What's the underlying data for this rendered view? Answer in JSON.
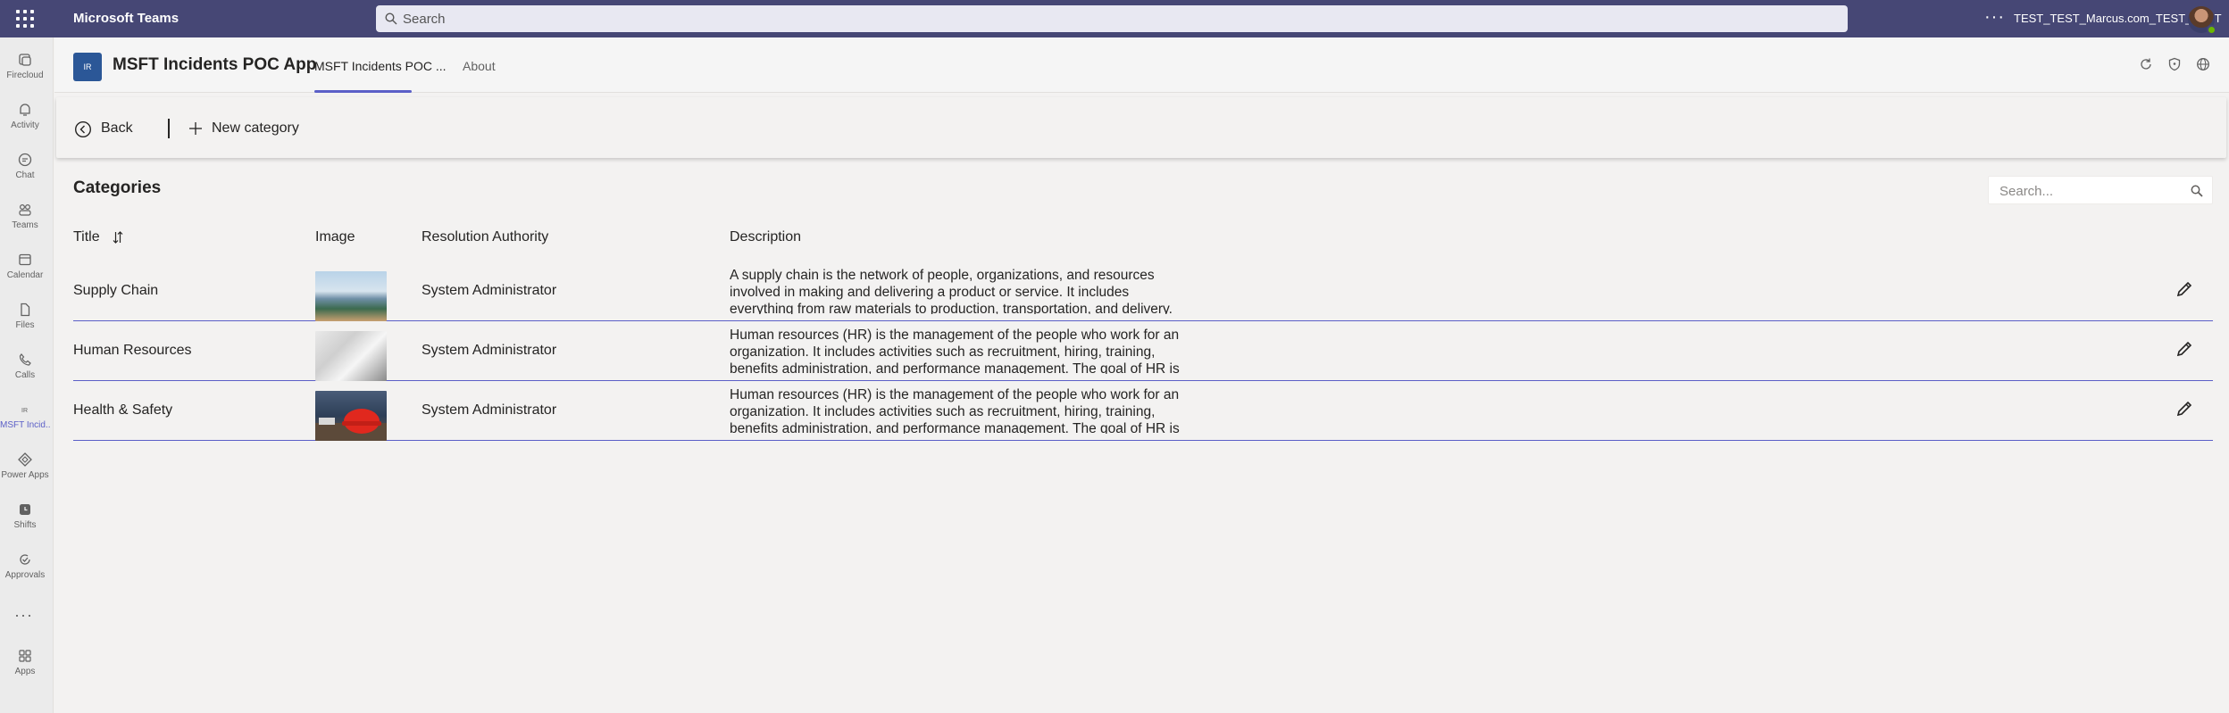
{
  "topbar": {
    "app_name": "Microsoft Teams",
    "search_placeholder": "Search",
    "more_label": "···",
    "user_name": "TEST_TEST_Marcus.com_TEST_TEST"
  },
  "rail": {
    "items": [
      {
        "label": "Firecloud",
        "icon": "firecloud-icon"
      },
      {
        "label": "Activity",
        "icon": "bell-icon"
      },
      {
        "label": "Chat",
        "icon": "chat-icon"
      },
      {
        "label": "Teams",
        "icon": "teams-icon"
      },
      {
        "label": "Calendar",
        "icon": "calendar-icon"
      },
      {
        "label": "Files",
        "icon": "file-icon"
      },
      {
        "label": "Calls",
        "icon": "phone-icon"
      },
      {
        "label": "MSFT Incid...",
        "icon": "app-icon",
        "active": true
      },
      {
        "label": "Power Apps",
        "icon": "power-apps-icon"
      },
      {
        "label": "Shifts",
        "icon": "clock-icon"
      },
      {
        "label": "Approvals",
        "icon": "approvals-icon"
      }
    ],
    "more": "···",
    "apps_label": "Apps"
  },
  "app_header": {
    "logo_text": "IR",
    "title": "MSFT Incidents POC App",
    "tabs": [
      {
        "label": "MSFT Incidents POC ...",
        "active": true
      },
      {
        "label": "About",
        "active": false
      }
    ]
  },
  "command_bar": {
    "back_label": "Back",
    "new_category_label": "New category"
  },
  "main": {
    "section_title": "Categories",
    "search_placeholder": "Search...",
    "columns": {
      "title": "Title",
      "image": "Image",
      "authority": "Resolution Authority",
      "description": "Description"
    },
    "rows": [
      {
        "title": "Supply Chain",
        "image": "supply-chain-photo",
        "authority": "System Administrator",
        "description": "A supply chain is the network of people, organizations, and resources involved in making and delivering a product or service. It includes everything from raw materials to production, transportation, and delivery."
      },
      {
        "title": "Human Resources",
        "image": "human-resources-photo",
        "authority": "System Administrator",
        "description": "Human resources (HR) is the management of the people who work for an organization. It includes activities such as recruitment, hiring, training, benefits administration, and performance management. The goal of HR is"
      },
      {
        "title": "Health & Safety",
        "image": "health-safety-photo",
        "authority": "System Administrator",
        "description": "Human resources (HR) is the management of the people who work for an organization. It includes activities such as recruitment, hiring, training, benefits administration, and performance management. The goal of HR is"
      }
    ]
  },
  "colors": {
    "topbar": "#464775",
    "accent": "#5b5fc7",
    "background": "#f3f2f1"
  }
}
